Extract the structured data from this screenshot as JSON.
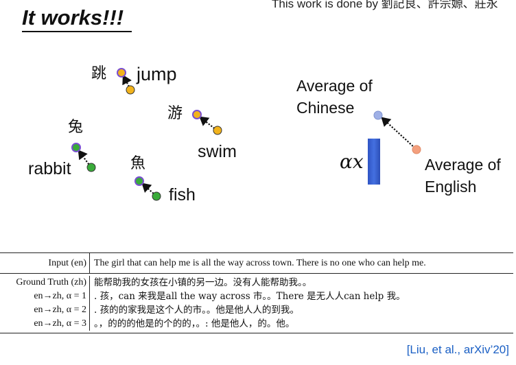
{
  "header": {
    "credit_text": "This work is done by 劉記良、許宗嫄、莊永",
    "title": "It works!!!"
  },
  "word_pairs": [
    {
      "zh": "跳",
      "en": "jump"
    },
    {
      "zh": "游",
      "en": "swim"
    },
    {
      "zh": "兔",
      "en": "rabbit"
    },
    {
      "zh": "魚",
      "en": "fish"
    }
  ],
  "averages": {
    "chinese_line1": "Average of",
    "chinese_line2": "Chinese",
    "english_line1": "Average of",
    "english_line2": "English",
    "scale_label": "αx"
  },
  "colors": {
    "orange_point": "#f2b31c",
    "green_point": "#3aab3a",
    "purple_ring": "#7a4fd1",
    "avg_chinese_point": "#9fb0e6",
    "avg_english_point": "#f4a07e",
    "bar": "#3a63d8",
    "citation": "#1a5fc4"
  },
  "table": {
    "input_label": "Input (en)",
    "input_text": "The girl that can help me is all the way across town. There is no one who can help me.",
    "rows": [
      {
        "label": "Ground Truth (zh)",
        "text": "能帮助我的女孩在小镇的另一边。没有人能帮助我。。"
      },
      {
        "label": "en→zh, α = 1",
        "text": ". 孩，can 来我是all the way across 市。。There 是无人人can help 我。"
      },
      {
        "label": "en→zh, α = 2",
        "text": ". 孩的的家我是这个人的市。。他是他人人的到我。"
      },
      {
        "label": "en→zh, α = 3",
        "text": "。，的的的他是的个的的，。: 他是他人，的。他。"
      }
    ]
  },
  "citation": "[Liu, et al., arXiv’20]"
}
